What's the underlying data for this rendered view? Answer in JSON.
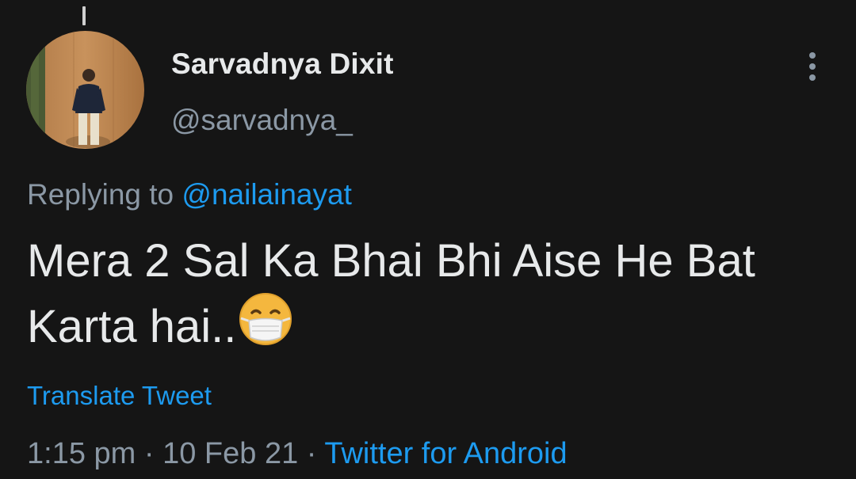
{
  "tweet": {
    "author_name": "Sarvadnya Dixit",
    "author_handle": "@sarvadnya_",
    "replying_prefix": "Replying to ",
    "replying_to": "@nailainayat",
    "text_line1": "Mera 2 Sal Ka Bhai Bhi Aise He Bat",
    "text_line2": "Karta hai..",
    "emoji": "face-with-medical-mask-emoji",
    "translate_label": "Translate Tweet",
    "time": "1:15 pm",
    "separator": " · ",
    "date": "10 Feb 21",
    "source": "Twitter for Android"
  },
  "icons": {
    "more": "more-vertical-icon",
    "avatar": "profile-photo"
  },
  "colors": {
    "background": "#151515",
    "primary_text": "#e7e9ea",
    "secondary_text": "#8b98a5",
    "link": "#1d9bf0"
  }
}
